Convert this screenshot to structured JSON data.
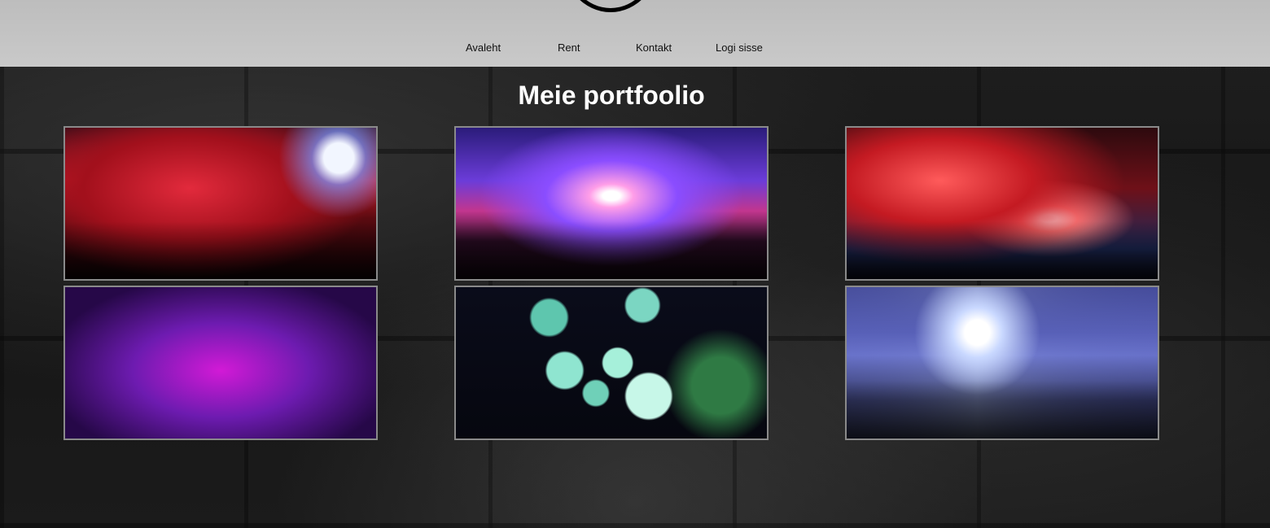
{
  "nav": {
    "items": [
      {
        "label": "Avaleht"
      },
      {
        "label": "Rent"
      },
      {
        "label": "Kontakt"
      },
      {
        "label": "Logi sisse"
      }
    ]
  },
  "main": {
    "title": "Meie portfoolio",
    "gallery": [
      {
        "subject": "red-confetti-crowd-photo"
      },
      {
        "subject": "stage-confetti-crowd-photo"
      },
      {
        "subject": "fireworks-palm-trees-photo"
      },
      {
        "subject": "neon-diamond-tunnel-photo"
      },
      {
        "subject": "disco-balls-photo"
      },
      {
        "subject": "laser-light-show-photo"
      }
    ]
  }
}
